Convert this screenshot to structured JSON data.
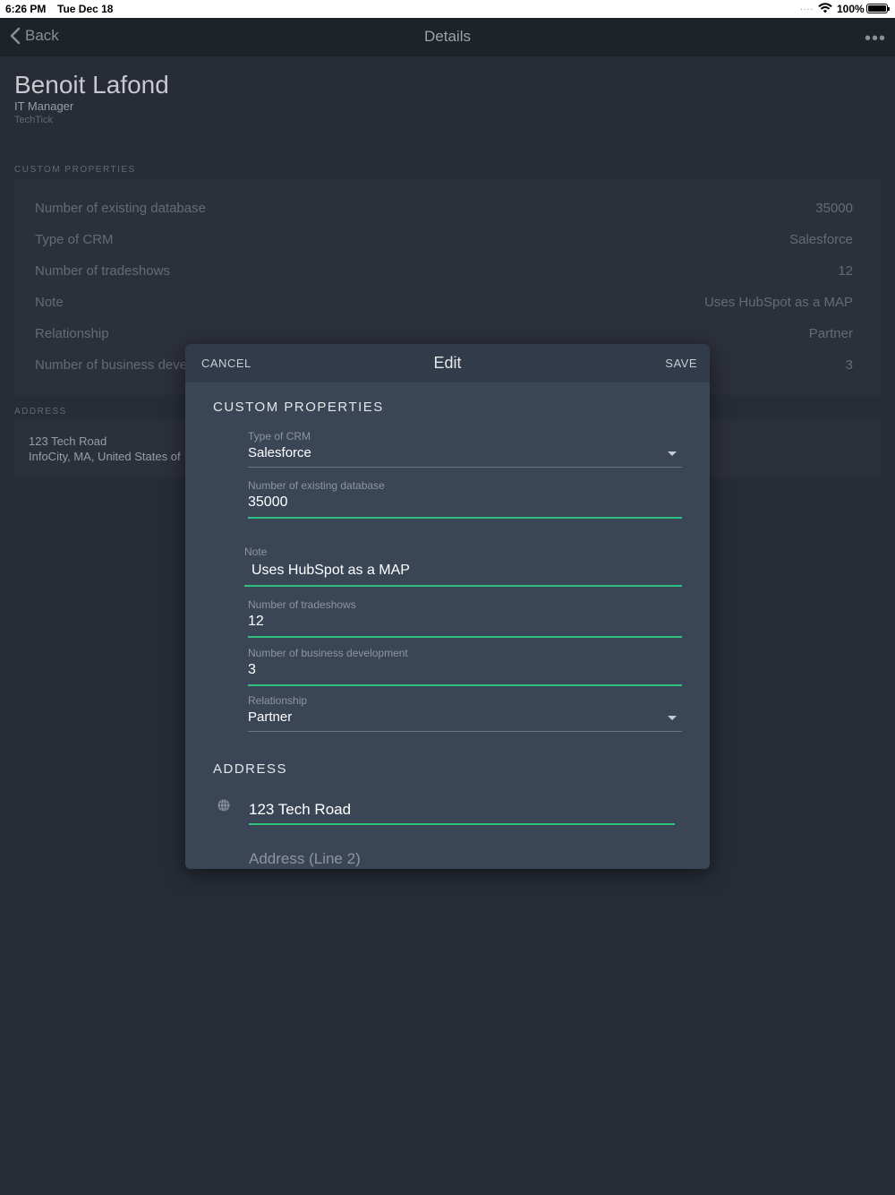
{
  "status_bar": {
    "time": "6:26 PM",
    "date": "Tue Dec 18",
    "signal": "....",
    "battery": "100%"
  },
  "nav": {
    "back_label": "Back",
    "title": "Details",
    "more": "•••"
  },
  "contact": {
    "name": "Benoit Lafond",
    "title": "IT Manager",
    "company": "TechTick"
  },
  "custom_properties": {
    "section_label": "CUSTOM PROPERTIES",
    "rows": [
      {
        "label": "Number of existing database",
        "value": "35000"
      },
      {
        "label": "Type of CRM",
        "value": "Salesforce"
      },
      {
        "label": "Number of tradeshows",
        "value": "12"
      },
      {
        "label": "Note",
        "value": "Uses HubSpot as a MAP"
      },
      {
        "label": "Relationship",
        "value": "Partner"
      },
      {
        "label": "Number of business deve",
        "value": "3"
      }
    ]
  },
  "address": {
    "section_label": "ADDRESS",
    "line1": "123 Tech Road",
    "line2": "InfoCity, MA, United States of"
  },
  "modal": {
    "cancel_label": "CANCEL",
    "title": "Edit",
    "save_label": "SAVE",
    "custom_properties_heading": "CUSTOM PROPERTIES",
    "fields": {
      "crm_type": {
        "label": "Type of CRM",
        "value": "Salesforce"
      },
      "existing_database": {
        "label": "Number of existing database",
        "value": "35000"
      },
      "note": {
        "label": "Note",
        "value": "Uses HubSpot as a MAP"
      },
      "tradeshows": {
        "label": "Number of tradeshows",
        "value": "12"
      },
      "business_development": {
        "label": "Number of business development",
        "value": "3"
      },
      "relationship": {
        "label": "Relationship",
        "value": "Partner"
      }
    },
    "address_heading": "ADDRESS",
    "address_line1": "123 Tech Road",
    "address_line2_placeholder": "Address (Line 2)"
  },
  "colors": {
    "accent_green": "#2ec27e",
    "background": "#2b303b",
    "modal": "#3a4556"
  },
  "icons": [
    "chevron-left-icon",
    "more-icon",
    "wifi-icon",
    "battery-icon",
    "globe-icon",
    "dropdown-caret-icon"
  ]
}
